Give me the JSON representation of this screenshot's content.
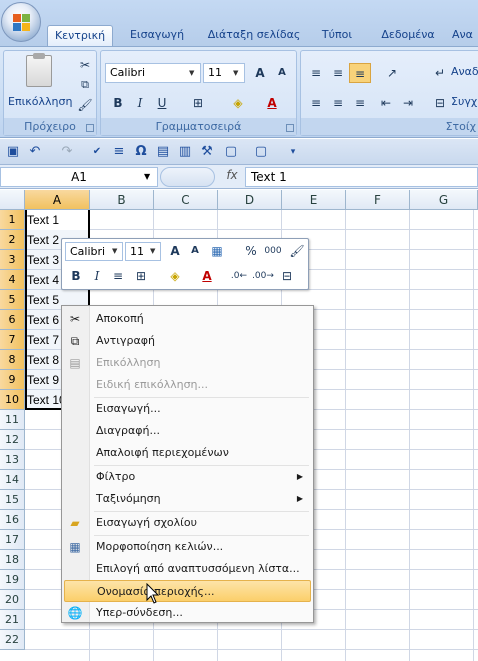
{
  "tabs": [
    {
      "label": "Κεντρική",
      "active": true
    },
    {
      "label": "Εισαγωγή"
    },
    {
      "label": "Διάταξη σελίδας"
    },
    {
      "label": "Τύποι"
    },
    {
      "label": "Δεδομένα"
    },
    {
      "label": "Ανα"
    }
  ],
  "clipboard": {
    "paste_label": "Επικόλληση",
    "group_caption": "Πρόχειρο"
  },
  "font": {
    "name": "Calibri",
    "size": "11",
    "group_caption": "Γραμματοσειρά"
  },
  "align": {
    "wrap_label": "Αναδ",
    "merge_label": "Συγχ",
    "group_caption": "Στοίχ"
  },
  "formula_bar": {
    "name_box": "A1",
    "fx": "fx",
    "formula": "Text 1"
  },
  "columns": [
    "A",
    "B",
    "C",
    "D",
    "E",
    "F",
    "G"
  ],
  "rows": [
    "1",
    "2",
    "3",
    "4",
    "5",
    "6",
    "7",
    "8",
    "9",
    "10",
    "11",
    "12",
    "13",
    "14",
    "15",
    "16",
    "17",
    "18",
    "19",
    "20",
    "21",
    "22"
  ],
  "cells": [
    "Text 1",
    "Text 2",
    "Text 3",
    "Text 4",
    "Text 5",
    "Text 6",
    "Text 7",
    "Text 8",
    "Text 9",
    "Text 10"
  ],
  "mini_toolbar": {
    "font": "Calibri",
    "size": "11",
    "percent": "%",
    "thousands": "000"
  },
  "context_menu": {
    "cut": "Αποκοπή",
    "copy": "Αντιγραφή",
    "paste": "Επικόλληση",
    "paste_special": "Ειδική επικόλληση...",
    "insert": "Εισαγωγή...",
    "delete": "Διαγραφή...",
    "clear": "Απαλοιφή περιεχομένων",
    "filter": "Φίλτρο",
    "sort": "Ταξινόμηση",
    "insert_comment": "Εισαγωγή σχολίου",
    "format_cells": "Μορφοποίηση κελιών...",
    "pick_list": "Επιλογή από αναπτυσσόμενη λίστα...",
    "name_range": "Ονομασία περιοχής...",
    "hyperlink": "Υπερ-σύνδεση..."
  }
}
